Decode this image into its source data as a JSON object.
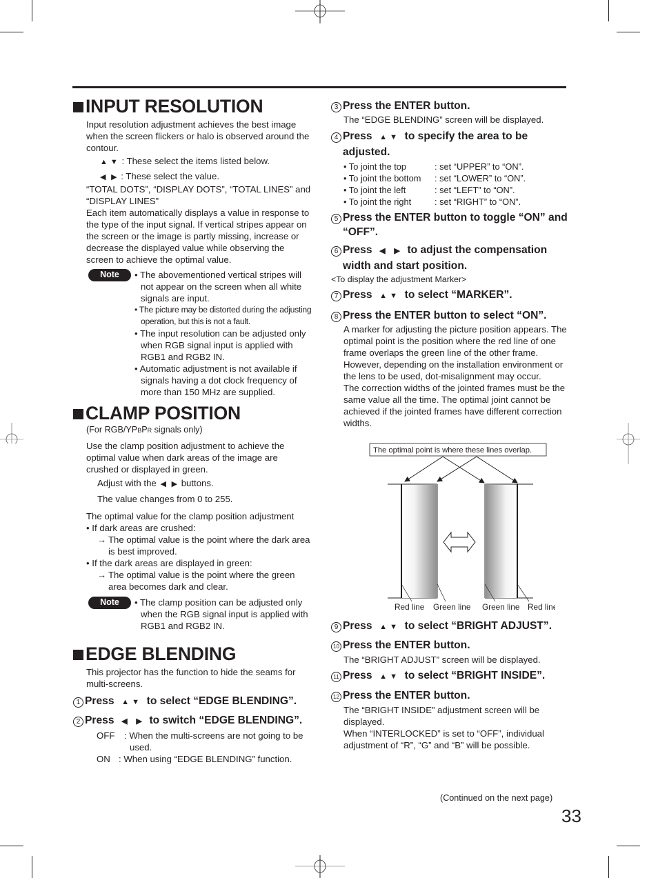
{
  "page": {
    "number": "33",
    "continued": "(Continued on the next page)"
  },
  "input_resolution": {
    "title": "INPUT RESOLUTION",
    "intro": "Input resolution adjustment achieves the best image when the screen flickers or halo is observed around the contour.",
    "updown_desc": ": These select the items listed below.",
    "leftright_desc": ": These select the value.",
    "items": "“TOTAL DOTS”, “DISPLAY DOTS”, “TOTAL LINES” and “DISPLAY LINES”",
    "para": "Each item automatically displays a value in response to the type of the input signal. If vertical stripes appear on the screen or the image is partly missing, increase or decrease the displayed value while observing the screen to achieve the optimal value.",
    "note_label": "Note",
    "notes": [
      "The abovementioned vertical stripes will not appear on the screen when all white signals are input.",
      "The picture may be distorted during the adjusting operation, but this is not a fault.",
      "The input resolution can be adjusted only when RGB signal input is applied with RGB1 and RGB2 IN.",
      "Automatic adjustment is not available if signals having a dot clock frequency of more than 150 MHz are supplied."
    ]
  },
  "clamp_position": {
    "title": "CLAMP POSITION",
    "scope_pre": "(For RGB/YP",
    "scope_b": "B",
    "scope_p": "P",
    "scope_r": "R",
    "scope_post": " signals only)",
    "intro": "Use the clamp position adjustment to achieve the optimal value when dark areas of the image are crushed or displayed in green.",
    "adjust_pre": "Adjust with the",
    "adjust_post": "buttons.",
    "range": "The value changes from 0 to 255.",
    "optimal_heading": "The optimal value for the clamp position adjustment",
    "case1": "• If dark areas are crushed:",
    "case1_result": "The optimal value is the point where the dark area is best improved.",
    "case2": "• If the dark areas are displayed in green:",
    "case2_result": "The optimal value is the point where the green area becomes dark and clear.",
    "note_label": "Note",
    "notes": [
      "The clamp position can be adjusted only when the RGB signal input is applied with RGB1 and RGB2 IN."
    ]
  },
  "edge_blending": {
    "title": "EDGE BLENDING",
    "intro": "This projector has the function to hide the seams for multi-screens.",
    "steps": [
      {
        "num": "1",
        "pre": "Press",
        "keys": "updown",
        "text": "to select “EDGE BLENDING”."
      },
      {
        "num": "2",
        "pre": "Press",
        "keys": "leftright",
        "text": "to switch “EDGE BLENDING”."
      },
      {
        "num": "3",
        "text": "Press the ENTER button."
      },
      {
        "num": "4",
        "pre": "Press",
        "keys": "updown",
        "text": "to specify the area to be adjusted."
      },
      {
        "num": "5",
        "text": "Press the ENTER button to toggle “ON” and “OFF”."
      },
      {
        "num": "6",
        "pre": "Press",
        "keys": "leftright",
        "text": "to adjust the compensation width and start position."
      },
      {
        "num": "7",
        "pre": "Press",
        "keys": "updown",
        "text": "to select “MARKER”."
      },
      {
        "num": "8",
        "text": "Press the ENTER button to select “ON”."
      },
      {
        "num": "9",
        "pre": "Press",
        "keys": "updown",
        "text": "to select “BRIGHT ADJUST”."
      },
      {
        "num": "10",
        "text": "Press the ENTER button."
      },
      {
        "num": "11",
        "pre": "Press",
        "keys": "updown",
        "text": "to select “BRIGHT INSIDE”."
      },
      {
        "num": "12",
        "text": "Press the ENTER button."
      }
    ],
    "step2_options": [
      {
        "key": "OFF",
        "desc": ": When the multi-screens are not going to be used."
      },
      {
        "key": "ON",
        "desc": ": When using “EDGE BLENDING” function."
      }
    ],
    "step3_desc": "The “EDGE BLENDING” screen will be displayed.",
    "step4_options": [
      {
        "key": "• To joint the top",
        "desc": ": set “UPPER” to “ON”."
      },
      {
        "key": "• To joint the bottom",
        "desc": ": set “LOWER” to “ON”."
      },
      {
        "key": "• To joint the left",
        "desc": ": set “LEFT” to “ON”."
      },
      {
        "key": "• To joint the right",
        "desc": ": set “RIGHT” to “ON”."
      }
    ],
    "marker_heading": "<To display the adjustment Marker>",
    "step8_desc": "A marker for adjusting the picture position appears. The optimal point is the position where the red line of one frame overlaps the green line of the other frame. However, depending on the installation environment or the lens to be used, dot-misalignment may occur.",
    "step8_desc2": "The correction widths of the jointed frames must be the same value all the time. The optimal joint cannot be achieved if the jointed frames have different correction widths.",
    "step10_desc": "The “BRIGHT ADJUST” screen will be displayed.",
    "step12_desc": "The “BRIGHT INSIDE” adjustment screen will be displayed.",
    "step12_desc2": "When “INTERLOCKED” is set to “OFF”, individual adjustment of “R”, “G” and “B” will be possible."
  },
  "diagram": {
    "callout": "The optimal point is where these lines overlap.",
    "labels": [
      "Red line",
      "Green line",
      "Green line",
      "Red line"
    ]
  },
  "icons": {
    "up": "▲",
    "down": "▼",
    "left": "◀",
    "right": "▶"
  }
}
